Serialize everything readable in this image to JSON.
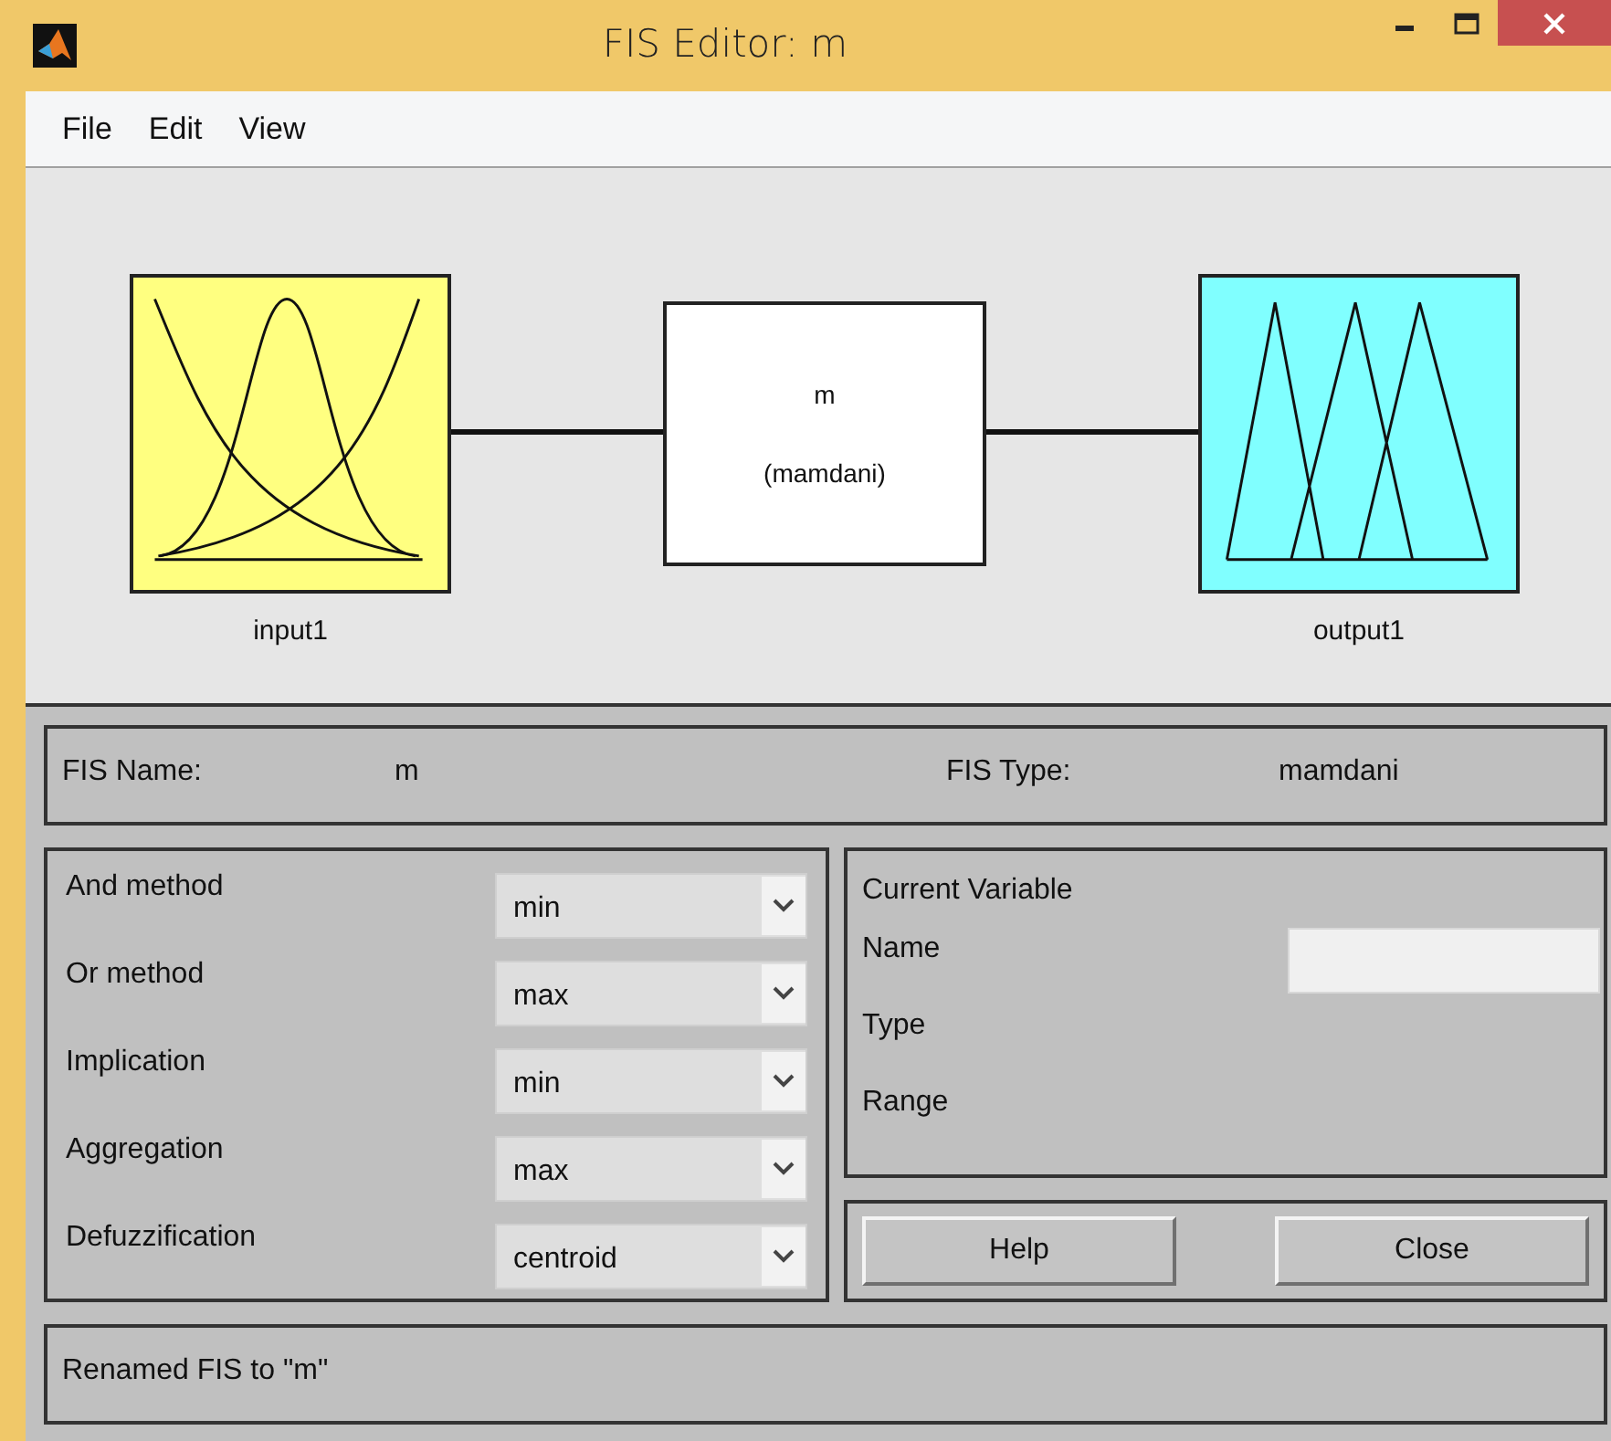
{
  "window": {
    "title": "FIS Editor: m"
  },
  "menu": [
    "File",
    "Edit",
    "View"
  ],
  "diagram": {
    "input": {
      "label": "input1",
      "kind": "gaussian"
    },
    "system": {
      "name": "m",
      "type": "(mamdani)"
    },
    "output": {
      "label": "output1",
      "kind": "triangular"
    }
  },
  "fis": {
    "name_label": "FIS Name:",
    "name": "m",
    "type_label": "FIS Type:",
    "type": "mamdani"
  },
  "methods": [
    {
      "label": "And method",
      "value": "min"
    },
    {
      "label": "Or method",
      "value": "max"
    },
    {
      "label": "Implication",
      "value": "min"
    },
    {
      "label": "Aggregation",
      "value": "max"
    },
    {
      "label": "Defuzzification",
      "value": "centroid"
    }
  ],
  "current_variable": {
    "title": "Current Variable",
    "fields": [
      {
        "label": "Name",
        "kind": "field"
      },
      {
        "label": "Type",
        "kind": "text"
      },
      {
        "label": "Range",
        "kind": "text"
      }
    ]
  },
  "buttons": [
    "Help",
    "Close"
  ],
  "status": "Renamed FIS to \"m\""
}
